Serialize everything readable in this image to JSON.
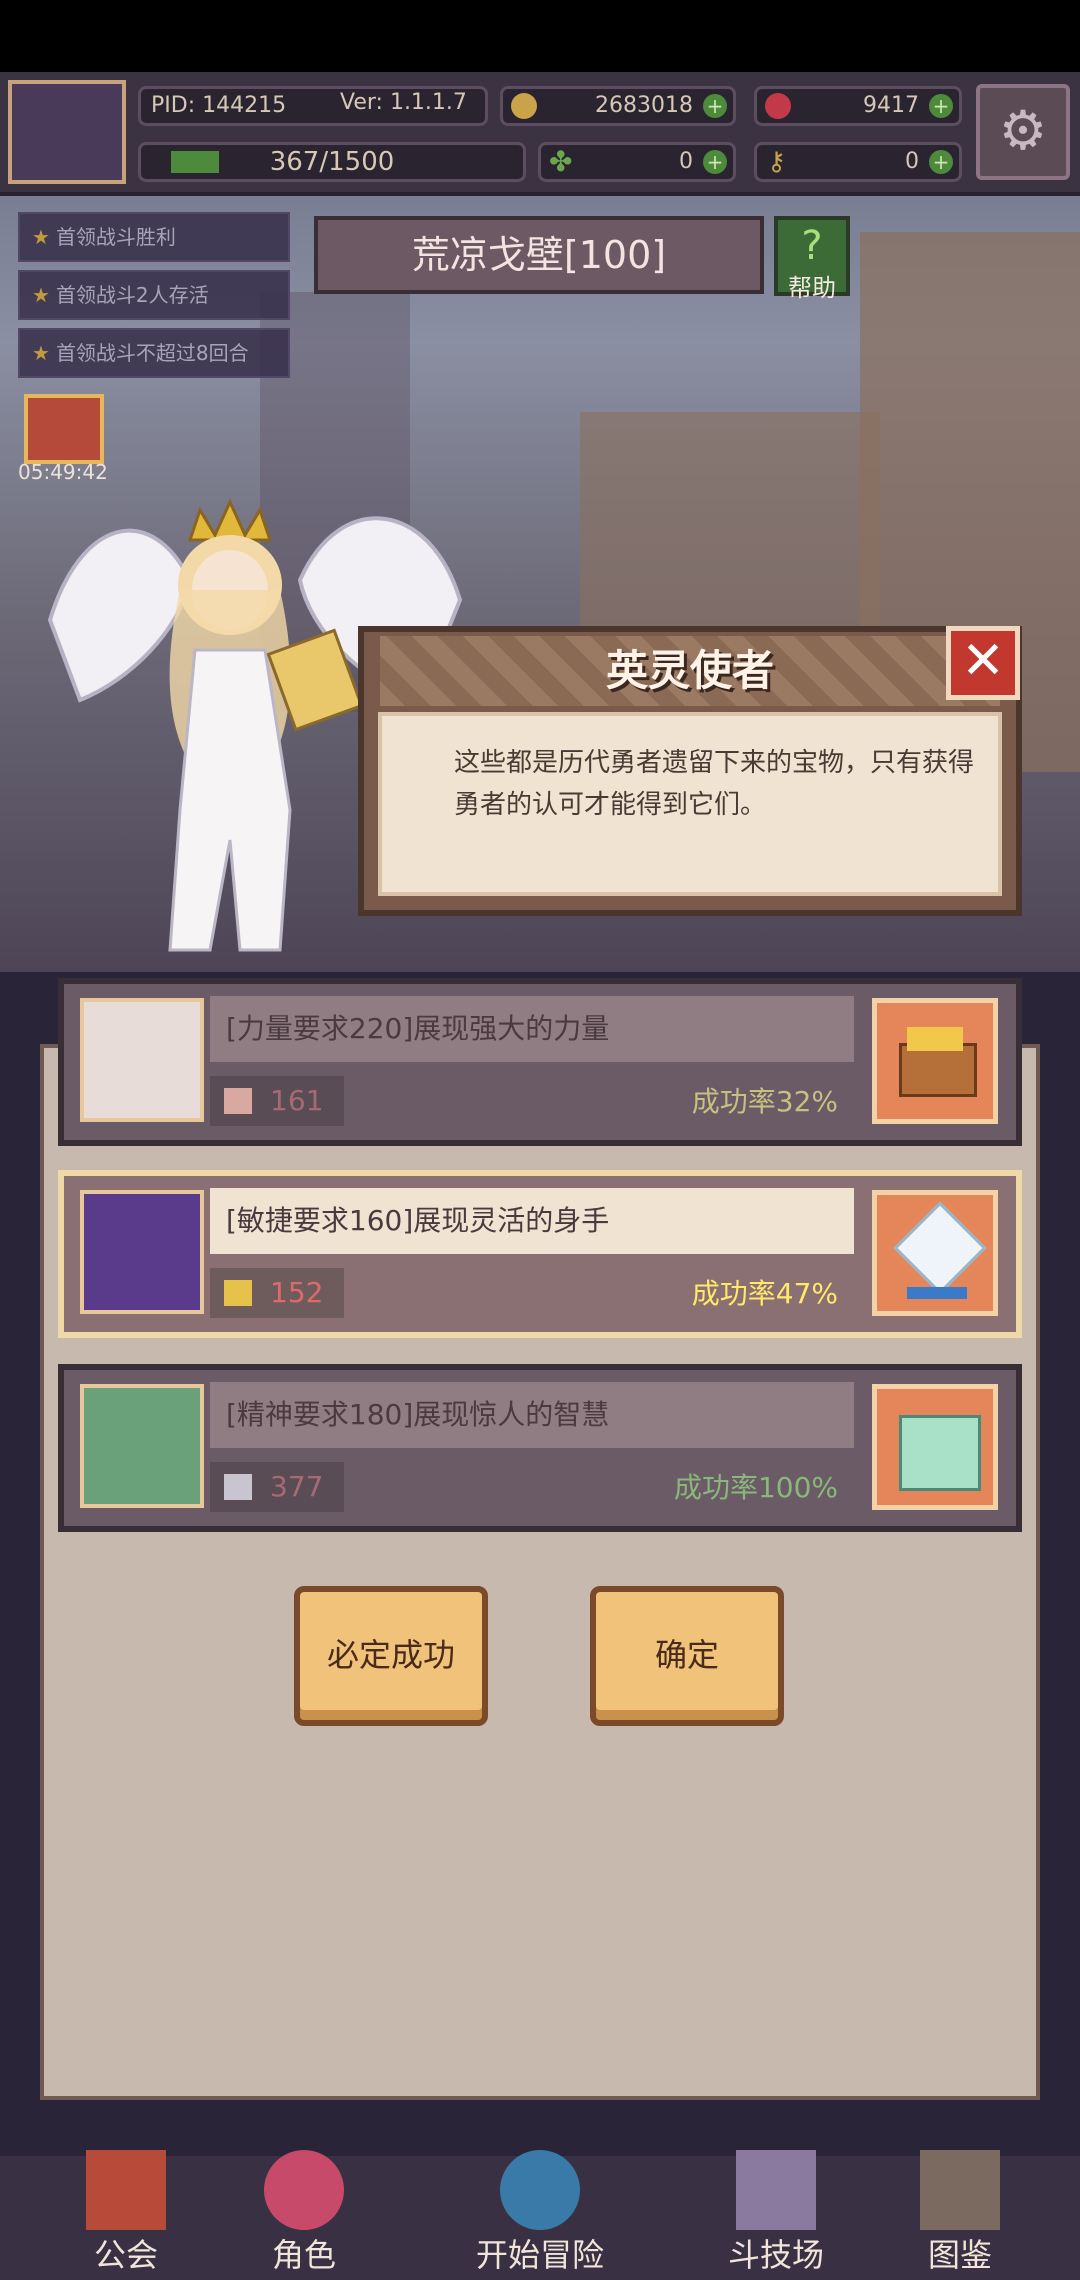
{
  "hud": {
    "pid": "PID: 144215",
    "version": "Ver: 1.1.1.7",
    "coins": "2683018",
    "gems": "9417",
    "exp": "367/1500",
    "clover": "0",
    "key": "0"
  },
  "quests": [
    "首领战斗胜利",
    "首领战斗2人存活",
    "首领战斗不超过8回合"
  ],
  "location": "荒凉戈壁[100]",
  "help_label": "帮助",
  "timer": "05:49:42",
  "dialog": {
    "title": "英灵使者",
    "text": "这些都是历代勇者遗留下来的宝物，只有获得勇者的认可才能得到它们。"
  },
  "options": [
    {
      "desc": "[力量要求220]展现强大的力量",
      "stat": "161",
      "rate": "成功率32%",
      "selected": false
    },
    {
      "desc": "[敏捷要求160]展现灵活的身手",
      "stat": "152",
      "rate": "成功率47%",
      "selected": true
    },
    {
      "desc": "[精神要求180]展现惊人的智慧",
      "stat": "377",
      "rate": "成功率100%",
      "selected": false
    }
  ],
  "buttons": {
    "guaranteed": "必定成功",
    "confirm": "确定"
  },
  "nav": [
    "公会",
    "角色",
    "开始冒险",
    "斗技场",
    "图鉴"
  ],
  "colors": {
    "accent": "#f0c27a",
    "close": "#c2382e",
    "rate_highlight": "#ffe86a"
  }
}
